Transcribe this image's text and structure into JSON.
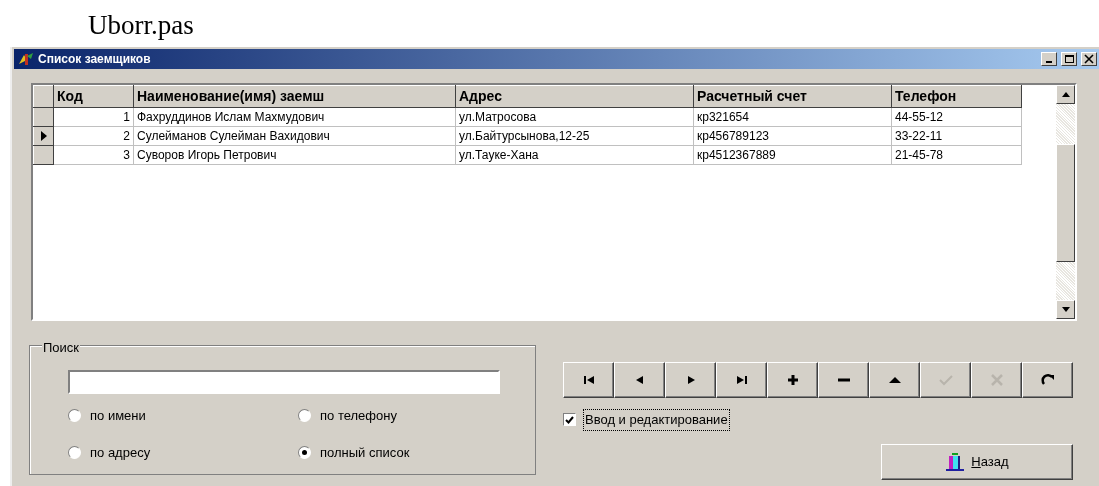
{
  "caption": "Uborr.pas",
  "window": {
    "title": "Список заемщиков",
    "controls": [
      {
        "kind": "minimize"
      },
      {
        "kind": "maximize"
      },
      {
        "kind": "close"
      }
    ]
  },
  "table": {
    "columns": [
      "Код",
      "Наименование(имя) заемш",
      "Адрес",
      "Расчетный счет",
      "Телефон"
    ],
    "rows": [
      {
        "selected": false,
        "cells": [
          "1",
          "Фахруддинов Ислам Махмудович",
          "ул.Матросова",
          "кр321654",
          "44-55-12"
        ]
      },
      {
        "selected": true,
        "cells": [
          "2",
          "Сулейманов Сулейман Вахидович",
          "ул.Байтурсынова,12-25",
          "кр456789123",
          "33-22-11"
        ]
      },
      {
        "selected": false,
        "cells": [
          "3",
          "Суворов Игорь Петрович",
          "ул.Тауке-Хана",
          "кр4512367889",
          "21-45-78"
        ]
      }
    ]
  },
  "search": {
    "title": "Поиск",
    "options": [
      {
        "label": "по имени",
        "selected": false
      },
      {
        "label": "по телефону",
        "selected": false
      },
      {
        "label": "по адресу",
        "selected": false
      },
      {
        "label": "полный список",
        "selected": true
      }
    ]
  },
  "navigator": [
    {
      "kind": "first",
      "disabled": false
    },
    {
      "kind": "prior",
      "disabled": false
    },
    {
      "kind": "next",
      "disabled": false
    },
    {
      "kind": "last",
      "disabled": false
    },
    {
      "kind": "insert",
      "disabled": false
    },
    {
      "kind": "delete",
      "disabled": false
    },
    {
      "kind": "edit",
      "disabled": false
    },
    {
      "kind": "post",
      "disabled": true
    },
    {
      "kind": "cancel",
      "disabled": true
    },
    {
      "kind": "refresh",
      "disabled": false
    }
  ],
  "edit_mode": {
    "label": "Ввод и редактирование",
    "checked": true
  },
  "back_button": {
    "label": "Назад"
  }
}
